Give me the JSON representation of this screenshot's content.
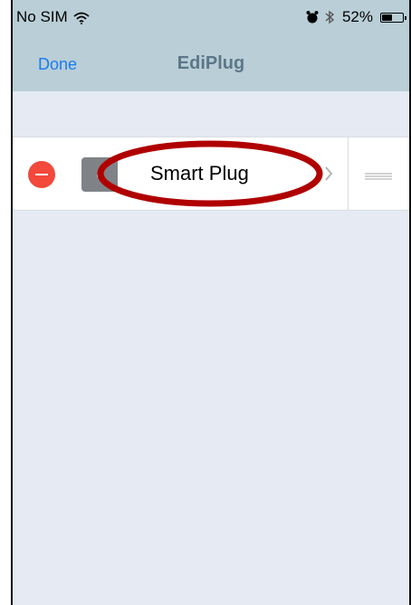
{
  "status_bar": {
    "carrier": "No SIM",
    "battery_text": "52%",
    "battery_level": 0.52,
    "icons": [
      "wifi-icon",
      "alarm-icon",
      "bluetooth-icon",
      "battery-icon"
    ]
  },
  "nav": {
    "done_label": "Done",
    "title": "EdiPlug"
  },
  "list": {
    "items": [
      {
        "label": "Smart Plug",
        "icons": [
          "delete-icon",
          "plug-icon",
          "chevron-right-icon",
          "reorder-icon"
        ]
      }
    ]
  },
  "colors": {
    "nav_bg": "#b9ced6",
    "page_bg": "#e6ebf3",
    "accent": "#1a7cf3",
    "title": "#5c7788",
    "delete": "#f2493b",
    "annotation": "#b00000"
  }
}
